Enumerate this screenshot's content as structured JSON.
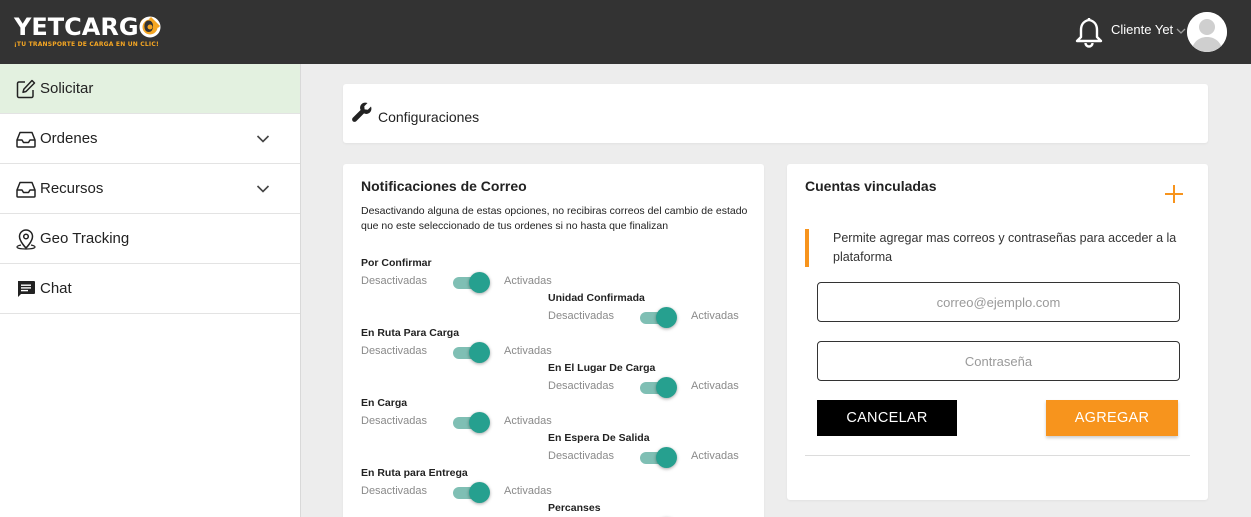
{
  "header": {
    "logo": {
      "brand_main": "YETCARG",
      "brand_tail": "O",
      "tagline": "¡TU TRANSPORTE DE CARGA EN UN CLIC!"
    },
    "user_name": "Cliente Yet",
    "icons": {
      "notifications": "bell-icon",
      "user_menu": "chevron-down-icon",
      "avatar": "avatar-icon"
    }
  },
  "sidebar": {
    "items": [
      {
        "label": "Solicitar",
        "icon": "edit-icon",
        "active": true,
        "has_chevron": false
      },
      {
        "label": "Ordenes",
        "icon": "inbox-icon",
        "active": false,
        "has_chevron": true
      },
      {
        "label": "Recursos",
        "icon": "inbox-icon",
        "active": false,
        "has_chevron": true
      },
      {
        "label": "Geo Tracking",
        "icon": "map-pin-icon",
        "active": false,
        "has_chevron": false
      },
      {
        "label": "Chat",
        "icon": "chat-icon",
        "active": false,
        "has_chevron": false
      }
    ]
  },
  "config_card": {
    "title": "Configuraciones",
    "icon": "wrench-icon"
  },
  "notifications": {
    "title": "Notificaciones de Correo",
    "description": "Desactivando alguna de estas opciones, no recibiras correos del cambio de estado que no este seleccionado de tus ordenes si no hasta que finalizan",
    "off_label": "Desactivadas",
    "on_label": "Activadas",
    "options": [
      {
        "label": "Por Confirmar",
        "enabled": true
      },
      {
        "label": "Unidad Confirmada",
        "enabled": true
      },
      {
        "label": "En Ruta Para Carga",
        "enabled": true
      },
      {
        "label": "En El Lugar De Carga",
        "enabled": true
      },
      {
        "label": "En Carga",
        "enabled": true
      },
      {
        "label": "En Espera De Salida",
        "enabled": true
      },
      {
        "label": "En Ruta para Entrega",
        "enabled": true
      },
      {
        "label": "Percanses",
        "enabled": true
      }
    ]
  },
  "accounts": {
    "title": "Cuentas vinculadas",
    "info": "Permite agregar mas correos y contraseñas para acceder a la plataforma",
    "email_placeholder": "correo@ejemplo.com",
    "email_value": "",
    "password_placeholder": "Contraseña",
    "password_value": "",
    "cancel_label": "CANCELAR",
    "add_label": "AGREGAR"
  },
  "colors": {
    "topbar": "#333333",
    "accent_orange": "#f7941d",
    "toggle_teal": "#26a08f",
    "active_nav": "#e3f1e0"
  }
}
